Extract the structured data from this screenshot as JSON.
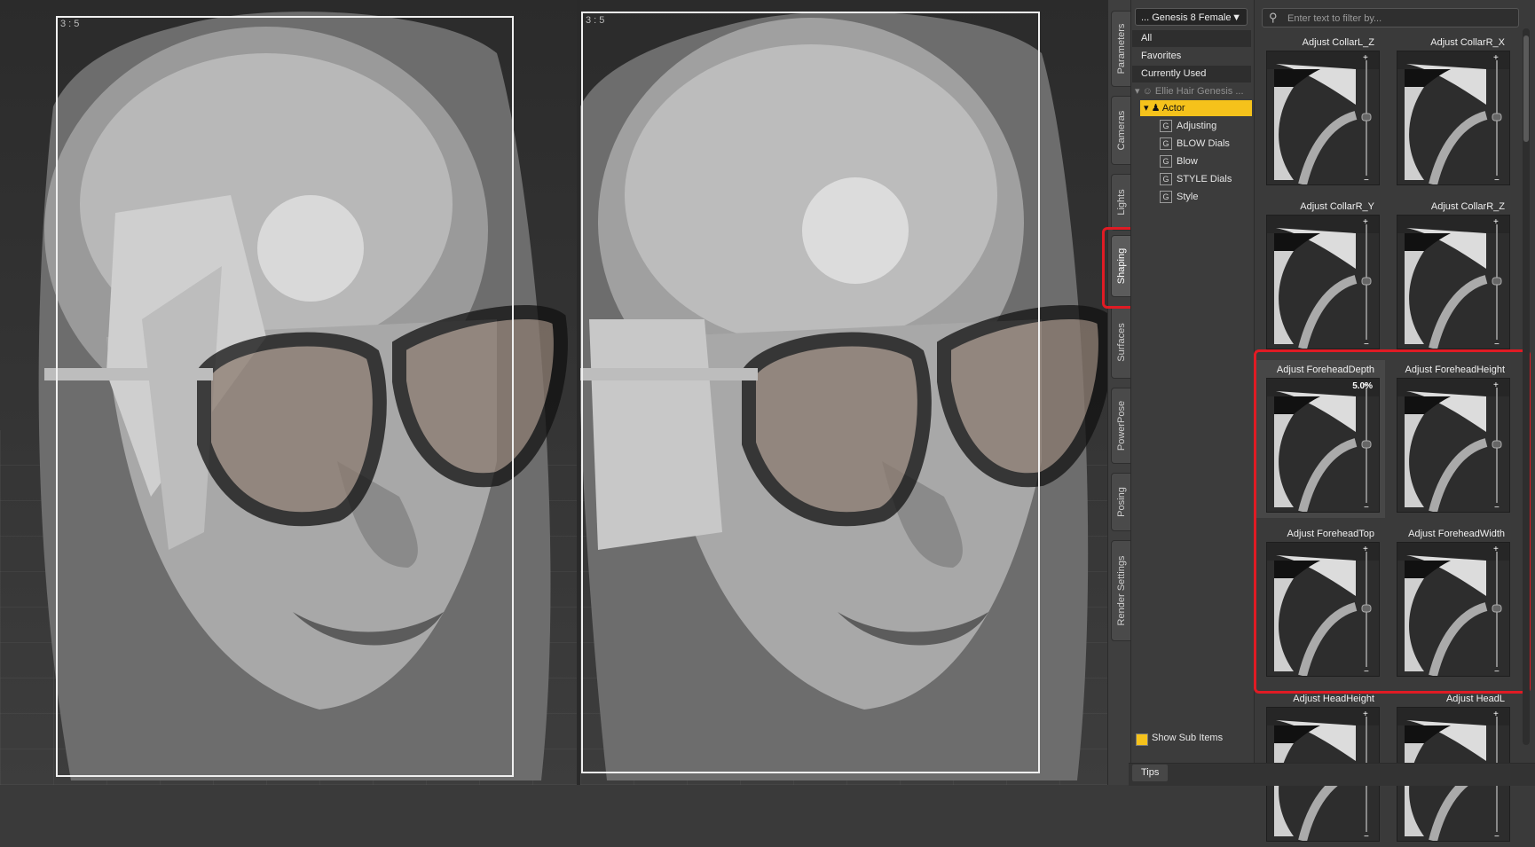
{
  "viewports": [
    {
      "aspect_label": "3 : 5"
    },
    {
      "aspect_label": "3 : 5"
    }
  ],
  "side_tabs": [
    "Parameters",
    "Cameras",
    "Lights",
    "Shaping",
    "Surfaces",
    "PowerPose",
    "Posing",
    "Render Settings"
  ],
  "active_tab": "Shaping",
  "scene_dropdown": {
    "label": "... Genesis 8 Female",
    "arrow": "▼"
  },
  "filter": {
    "placeholder": "Enter text to filter by..."
  },
  "filter_lists": [
    "All",
    "Favorites",
    "Currently Used"
  ],
  "tree": {
    "root": "Ellie Hair Genesis ...",
    "selected": "Actor",
    "groups": [
      "Adjusting",
      "BLOW Dials",
      "Blow",
      "STYLE Dials",
      "Style"
    ]
  },
  "dials": [
    {
      "label": "Adjust CollarL_Z"
    },
    {
      "label": "Adjust CollarR_X"
    },
    {
      "label": "Adjust CollarR_Y"
    },
    {
      "label": "Adjust CollarR_Z"
    },
    {
      "label": "Adjust ForeheadDepth",
      "value": "5.0%"
    },
    {
      "label": "Adjust ForeheadHeight"
    },
    {
      "label": "Adjust ForeheadTop"
    },
    {
      "label": "Adjust ForeheadWidth"
    },
    {
      "label": "Adjust HeadHeight"
    },
    {
      "label": "Adjust HeadL"
    }
  ],
  "show_sub_items": {
    "label": "Show Sub Items",
    "checked": true
  },
  "tips": {
    "label": "Tips"
  }
}
